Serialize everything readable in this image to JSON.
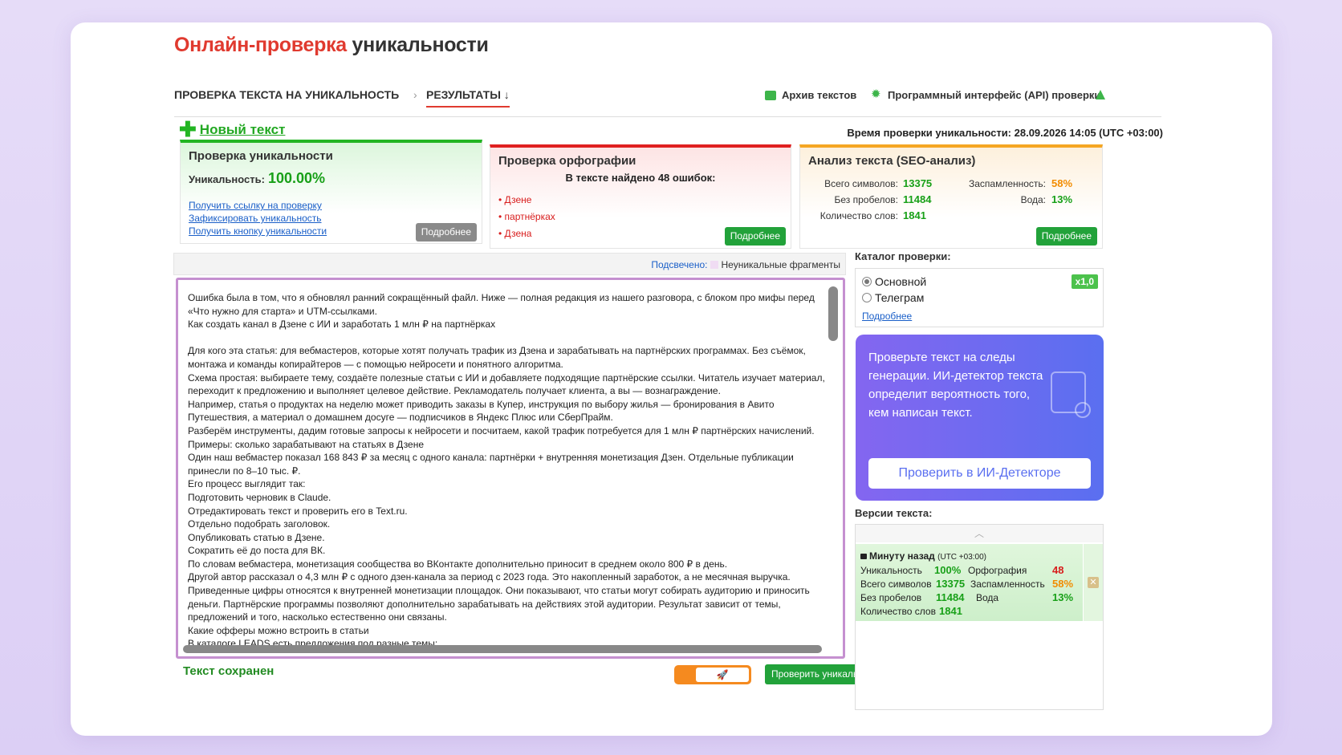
{
  "header": {
    "title_accent": "Онлайн-проверка",
    "title_rest": " уникальности"
  },
  "nav": {
    "crumb1": "ПРОВЕРКА ТЕКСТА НА УНИКАЛЬНОСТЬ",
    "crumb_sep": "›",
    "crumb2": "РЕЗУЛЬТАТЫ ↓",
    "archive": "Архив текстов",
    "api": "Программный интерфейс (API) проверки"
  },
  "new_text": "Новый текст",
  "check_time": "Время проверки уникальности: 28.09.2026 14:05 (UTC +03:00)",
  "uniqueness": {
    "title": "Проверка уникальности",
    "label": "Уникальность:",
    "value": "100.00%",
    "links": [
      "Получить ссылку на проверку",
      "Зафиксировать уникальность",
      "Получить кнопку уникальности"
    ],
    "more": "Подробнее"
  },
  "spelling": {
    "title": "Проверка орфографии",
    "summary": "В тексте найдено 48 ошибок:",
    "errors": [
      "Дзене",
      "партнёрках",
      "Дзена"
    ],
    "more": "Подробнее"
  },
  "seo": {
    "title": "Анализ текста (SEO-анализ)",
    "total_label": "Всего символов:",
    "total_value": "13375",
    "nospace_label": "Без пробелов:",
    "nospace_value": "11484",
    "words_label": "Количество слов:",
    "words_value": "1841",
    "spam_label": "Заспамленность:",
    "spam_value": "58%",
    "water_label": "Вода:",
    "water_value": "13%",
    "more": "Подробнее"
  },
  "editor": {
    "legend_label": "Подсвечено:",
    "legend_text": "Неуникальные фрагменты",
    "text": "Ошибка была в том, что я обновлял ранний сокращённый файл. Ниже — полная редакция из нашего разговора, с блоком про мифы перед «Что нужно для старта» и UTM-ссылками.\nКак создать канал в Дзене с ИИ и заработать 1 млн ₽ на партнёрках\n\nДля кого эта статья: для вебмастеров, которые хотят получать трафик из Дзена и зарабатывать на партнёрских программах. Без съёмок, монтажа и команды копирайтеров — с помощью нейросети и понятного алгоритма.\nСхема простая: выбираете тему, создаёте полезные статьи с ИИ и добавляете подходящие партнёрские ссылки. Читатель изучает материал, переходит к предложению и выполняет целевое действие. Рекламодатель получает клиента, а вы — вознаграждение.\nНапример, статья о продуктах на неделю может приводить заказы в Купер, инструкция по выбору жилья — бронирования в Авито Путешествия, а материал о домашнем досуге — подписчиков в Яндекс Плюс или СберПрайм.\nРазберём инструменты, дадим готовые запросы к нейросети и посчитаем, какой трафик потребуется для 1 млн ₽ партнёрских начислений.\nПримеры: сколько зарабатывают на статьях в Дзене\nОдин наш вебмастер показал 168 843 ₽ за месяц с одного канала: партнёрки + внутренняя монетизация Дзен. Отдельные публикации принесли по 8–10 тыс. ₽.\nЕго процесс выглядит так:\nПодготовить черновик в Claude.\nОтредактировать текст и проверить его в Text.ru.\nОтдельно подобрать заголовок.\nОпубликовать статью в Дзене.\nСократить её до поста для ВК.\nПо словам вебмастера, монетизация сообщества во ВКонтакте дополнительно приносит в среднем около 800 ₽ в день.\nДругой автор рассказал о 4,3 млн ₽ с одного дзен-канала за период с 2023 года. Это накопленный заработок, а не месячная выручка.\nПриведенные цифры относятся к внутренней монетизации площадок. Они показывают, что статьи могут собирать аудиторию и приносить деньги. Партнёрские программы позволяют дополнительно зарабатывать на действиях этой аудитории. Результат зависит от темы, предложений и того, насколько естественно они связаны.\nКакие офферы можно встроить в статьи\nВ каталоге LEADS есть предложения под разные темы:"
  },
  "footer": {
    "saved": "Текст сохранен",
    "check_button": "Проверить уникальность"
  },
  "catalog": {
    "label": "Каталог проверки:",
    "options": [
      "Основной",
      "Телеграм"
    ],
    "selected": "Основной",
    "multiplier": "x1,0",
    "more": "Подробнее"
  },
  "promo": {
    "text": "Проверьте текст на следы генерации. ИИ-детектор текста определит вероятность того, кем написан текст.",
    "button": "Проверить в ИИ-Детекторе"
  },
  "versions": {
    "label": "Версии текста:",
    "item": {
      "time": "Минуту назад",
      "tz": "(UTC +03:00)",
      "uniq_label": "Уникальность",
      "uniq_value": "100%",
      "spell_label": "Орфография",
      "spell_value": "48",
      "total_label": "Всего символов",
      "total_value": "13375",
      "spam_label": "Заспамленность",
      "spam_value": "58%",
      "nospace_label": "Без пробелов",
      "nospace_value": "11484",
      "water_label": "Вода",
      "water_value": "13%",
      "words_label": "Количество слов",
      "words_value": "1841"
    }
  },
  "colors": {
    "accent_red": "#e03a2f",
    "green": "#22a23a",
    "orange": "#f58a1f",
    "promo": "#6b6af0"
  }
}
